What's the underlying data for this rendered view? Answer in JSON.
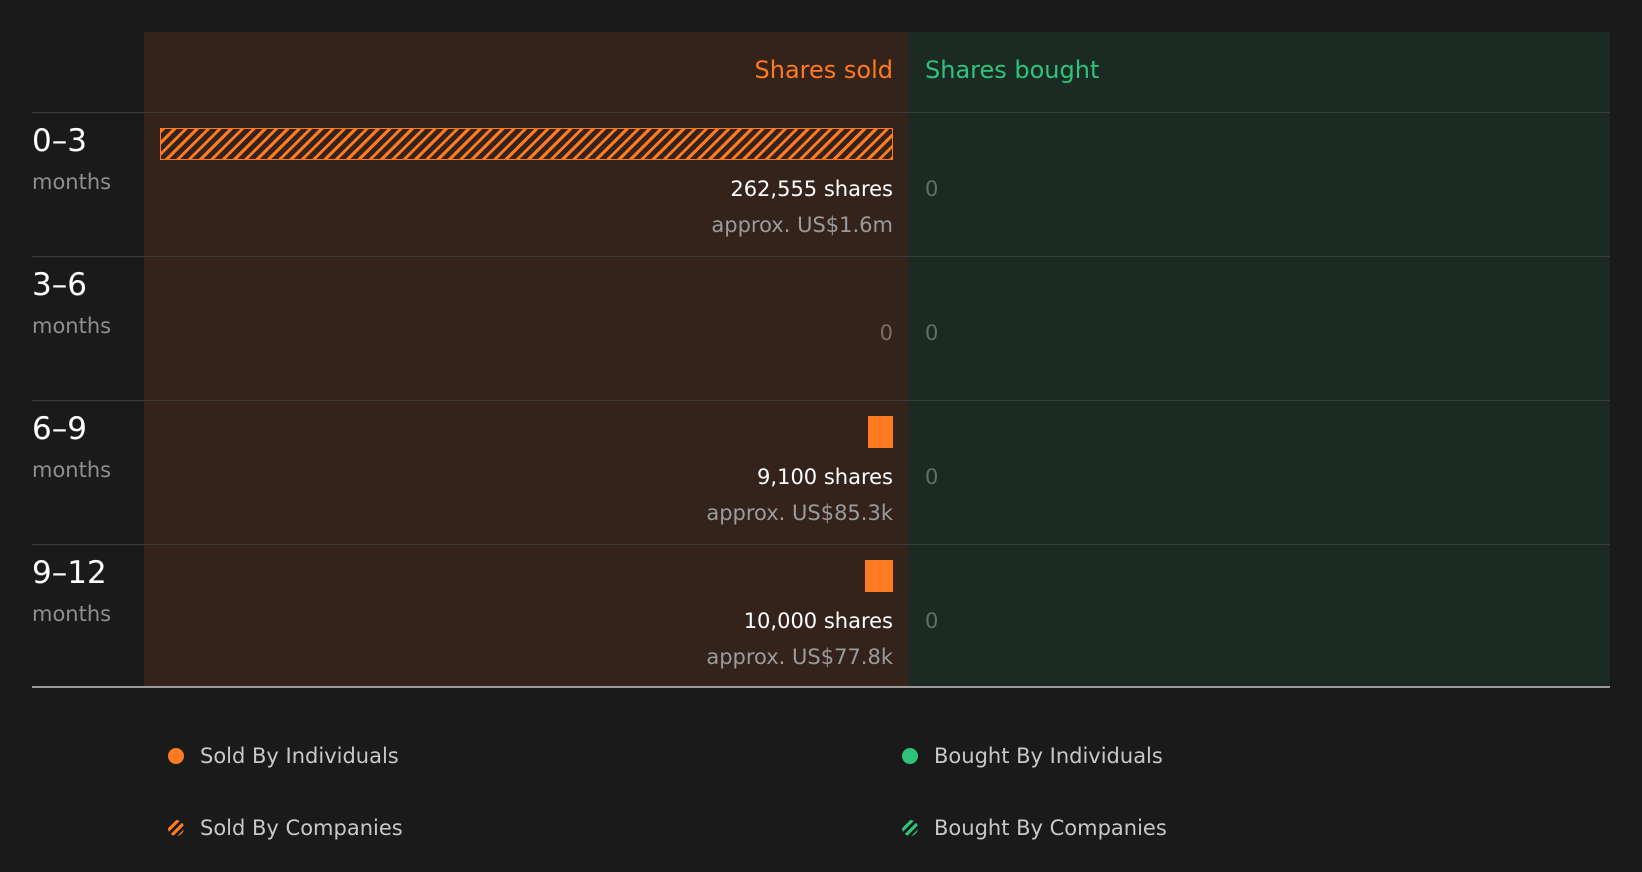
{
  "colors": {
    "sold": "#ff7a21",
    "bought": "#2fc37a",
    "sold_bg": "#33231b",
    "bought_bg": "#1c2a24",
    "page_bg": "#1a1a1a"
  },
  "headers": {
    "sold": "Shares sold",
    "bought": "Shares bought"
  },
  "rows": [
    {
      "range": "0–3",
      "unit": "months",
      "sold_shares": "262,555 shares",
      "sold_approx": "approx. US$1.6m",
      "sold_zero": "",
      "bought_zero": "0"
    },
    {
      "range": "3–6",
      "unit": "months",
      "sold_shares": "",
      "sold_approx": "",
      "sold_zero": "0",
      "bought_zero": "0"
    },
    {
      "range": "6–9",
      "unit": "months",
      "sold_shares": "9,100 shares",
      "sold_approx": "approx. US$85.3k",
      "sold_zero": "",
      "bought_zero": "0"
    },
    {
      "range": "9–12",
      "unit": "months",
      "sold_shares": "10,000 shares",
      "sold_approx": "approx. US$77.8k",
      "sold_zero": "",
      "bought_zero": "0"
    }
  ],
  "legend": [
    {
      "label": "Sold By Individuals",
      "icon": "sold-individuals-dot"
    },
    {
      "label": "Bought By Individuals",
      "icon": "bought-individuals-dot"
    },
    {
      "label": "Sold By Companies",
      "icon": "sold-companies-hatched-dot"
    },
    {
      "label": "Bought By Companies",
      "icon": "bought-companies-hatched-dot"
    }
  ],
  "chart_data": {
    "type": "bar",
    "orientation": "horizontal-diverging",
    "categories": [
      "0–3 months",
      "3–6 months",
      "6–9 months",
      "9–12 months"
    ],
    "series": [
      {
        "name": "Sold By Individuals",
        "values": [
          0,
          0,
          9100,
          10000
        ]
      },
      {
        "name": "Sold By Companies",
        "values": [
          262555,
          0,
          0,
          0
        ]
      },
      {
        "name": "Bought By Individuals",
        "values": [
          0,
          0,
          0,
          0
        ]
      },
      {
        "name": "Bought By Companies",
        "values": [
          0,
          0,
          0,
          0
        ]
      }
    ],
    "value_labels": [
      "approx. US$1.6m",
      "",
      "approx. US$85.3k",
      "approx. US$77.8k"
    ],
    "max_value": 262555
  }
}
